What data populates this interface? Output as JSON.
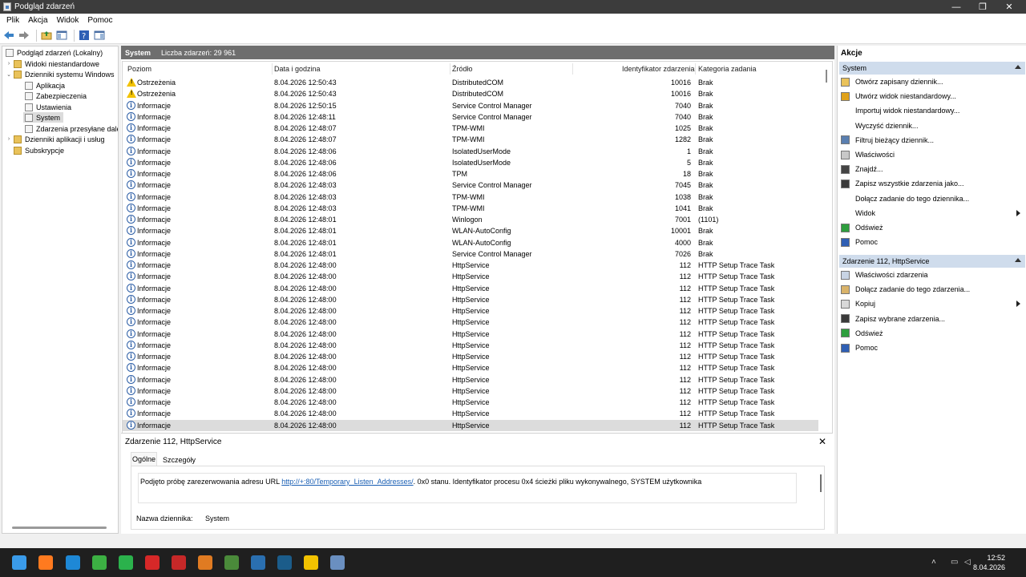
{
  "window": {
    "title": "Podgląd zdarzeń",
    "controls": [
      "—",
      "❐",
      "✕"
    ]
  },
  "menu": [
    "Plik",
    "Akcja",
    "Widok",
    "Pomoc"
  ],
  "toolbar": {
    "icons": [
      "back-arrow-icon",
      "forward-arrow-icon",
      "folder-up-icon",
      "show-hide-tree-icon",
      "help-icon",
      "show-hide-actions-icon"
    ]
  },
  "tree": {
    "items": [
      {
        "label": "Podgląd zdarzeń (Lokalny)",
        "level": 0,
        "arrow": "",
        "icon": "eventviewer-icon"
      },
      {
        "label": "Widoki niestandardowe",
        "level": 1,
        "arrow": "›",
        "icon": "folder-icon"
      },
      {
        "label": "Dzienniki systemu Windows",
        "level": 1,
        "arrow": "⌄",
        "icon": "folder-icon"
      },
      {
        "label": "Aplikacja",
        "level": 2,
        "arrow": "",
        "icon": "log-icon"
      },
      {
        "label": "Zabezpieczenia",
        "level": 2,
        "arrow": "",
        "icon": "log-icon"
      },
      {
        "label": "Ustawienia",
        "level": 2,
        "arrow": "",
        "icon": "log-icon"
      },
      {
        "label": "System",
        "level": 2,
        "arrow": "",
        "icon": "log-icon",
        "selected": true
      },
      {
        "label": "Zdarzenia przesyłane dale",
        "level": 2,
        "arrow": "",
        "icon": "log-icon"
      },
      {
        "label": "Dzienniki aplikacji i usług",
        "level": 1,
        "arrow": "›",
        "icon": "folder-icon"
      },
      {
        "label": "Subskrypcje",
        "level": 1,
        "arrow": "",
        "icon": "folder-icon"
      }
    ]
  },
  "center": {
    "log_name": "System",
    "count_label": "Liczba zdarzeń: 29 961",
    "columns": [
      "Poziom",
      "Data i godzina",
      "Źródło",
      "Identyfikator zdarzenia",
      "Kategoria zadania"
    ],
    "rows": [
      {
        "level": "Ostrzeżenia",
        "type": "warning",
        "date": "8.04.2026 12:50:43",
        "source": "DistributedCOM",
        "id": "10016",
        "category": "Brak"
      },
      {
        "level": "Ostrzeżenia",
        "type": "warning",
        "date": "8.04.2026 12:50:43",
        "source": "DistributedCOM",
        "id": "10016",
        "category": "Brak"
      },
      {
        "level": "Informacje",
        "type": "info",
        "date": "8.04.2026 12:50:15",
        "source": "Service Control Manager",
        "id": "7040",
        "category": "Brak"
      },
      {
        "level": "Informacje",
        "type": "info",
        "date": "8.04.2026 12:48:11",
        "source": "Service Control Manager",
        "id": "7040",
        "category": "Brak"
      },
      {
        "level": "Informacje",
        "type": "info",
        "date": "8.04.2026 12:48:07",
        "source": "TPM-WMI",
        "id": "1025",
        "category": "Brak"
      },
      {
        "level": "Informacje",
        "type": "info",
        "date": "8.04.2026 12:48:07",
        "source": "TPM-WMI",
        "id": "1282",
        "category": "Brak"
      },
      {
        "level": "Informacje",
        "type": "info",
        "date": "8.04.2026 12:48:06",
        "source": "IsolatedUserMode",
        "id": "1",
        "category": "Brak"
      },
      {
        "level": "Informacje",
        "type": "info",
        "date": "8.04.2026 12:48:06",
        "source": "IsolatedUserMode",
        "id": "5",
        "category": "Brak"
      },
      {
        "level": "Informacje",
        "type": "info",
        "date": "8.04.2026 12:48:06",
        "source": "TPM",
        "id": "18",
        "category": "Brak"
      },
      {
        "level": "Informacje",
        "type": "info",
        "date": "8.04.2026 12:48:03",
        "source": "Service Control Manager",
        "id": "7045",
        "category": "Brak"
      },
      {
        "level": "Informacje",
        "type": "info",
        "date": "8.04.2026 12:48:03",
        "source": "TPM-WMI",
        "id": "1038",
        "category": "Brak"
      },
      {
        "level": "Informacje",
        "type": "info",
        "date": "8.04.2026 12:48:03",
        "source": "TPM-WMI",
        "id": "1041",
        "category": "Brak"
      },
      {
        "level": "Informacje",
        "type": "info",
        "date": "8.04.2026 12:48:01",
        "source": "Winlogon",
        "id": "7001",
        "category": "(1101)"
      },
      {
        "level": "Informacje",
        "type": "info",
        "date": "8.04.2026 12:48:01",
        "source": "WLAN-AutoConfig",
        "id": "10001",
        "category": "Brak"
      },
      {
        "level": "Informacje",
        "type": "info",
        "date": "8.04.2026 12:48:01",
        "source": "WLAN-AutoConfig",
        "id": "4000",
        "category": "Brak"
      },
      {
        "level": "Informacje",
        "type": "info",
        "date": "8.04.2026 12:48:01",
        "source": "Service Control Manager",
        "id": "7026",
        "category": "Brak"
      },
      {
        "level": "Informacje",
        "type": "info",
        "date": "8.04.2026 12:48:00",
        "source": "HttpService",
        "id": "112",
        "category": "HTTP Setup Trace Task"
      },
      {
        "level": "Informacje",
        "type": "info",
        "date": "8.04.2026 12:48:00",
        "source": "HttpService",
        "id": "112",
        "category": "HTTP Setup Trace Task"
      },
      {
        "level": "Informacje",
        "type": "info",
        "date": "8.04.2026 12:48:00",
        "source": "HttpService",
        "id": "112",
        "category": "HTTP Setup Trace Task"
      },
      {
        "level": "Informacje",
        "type": "info",
        "date": "8.04.2026 12:48:00",
        "source": "HttpService",
        "id": "112",
        "category": "HTTP Setup Trace Task"
      },
      {
        "level": "Informacje",
        "type": "info",
        "date": "8.04.2026 12:48:00",
        "source": "HttpService",
        "id": "112",
        "category": "HTTP Setup Trace Task"
      },
      {
        "level": "Informacje",
        "type": "info",
        "date": "8.04.2026 12:48:00",
        "source": "HttpService",
        "id": "112",
        "category": "HTTP Setup Trace Task"
      },
      {
        "level": "Informacje",
        "type": "info",
        "date": "8.04.2026 12:48:00",
        "source": "HttpService",
        "id": "112",
        "category": "HTTP Setup Trace Task"
      },
      {
        "level": "Informacje",
        "type": "info",
        "date": "8.04.2026 12:48:00",
        "source": "HttpService",
        "id": "112",
        "category": "HTTP Setup Trace Task"
      },
      {
        "level": "Informacje",
        "type": "info",
        "date": "8.04.2026 12:48:00",
        "source": "HttpService",
        "id": "112",
        "category": "HTTP Setup Trace Task"
      },
      {
        "level": "Informacje",
        "type": "info",
        "date": "8.04.2026 12:48:00",
        "source": "HttpService",
        "id": "112",
        "category": "HTTP Setup Trace Task"
      },
      {
        "level": "Informacje",
        "type": "info",
        "date": "8.04.2026 12:48:00",
        "source": "HttpService",
        "id": "112",
        "category": "HTTP Setup Trace Task"
      },
      {
        "level": "Informacje",
        "type": "info",
        "date": "8.04.2026 12:48:00",
        "source": "HttpService",
        "id": "112",
        "category": "HTTP Setup Trace Task"
      },
      {
        "level": "Informacje",
        "type": "info",
        "date": "8.04.2026 12:48:00",
        "source": "HttpService",
        "id": "112",
        "category": "HTTP Setup Trace Task"
      },
      {
        "level": "Informacje",
        "type": "info",
        "date": "8.04.2026 12:48:00",
        "source": "HttpService",
        "id": "112",
        "category": "HTTP Setup Trace Task"
      },
      {
        "level": "Informacje",
        "type": "info",
        "date": "8.04.2026 12:48:00",
        "source": "HttpService",
        "id": "112",
        "category": "HTTP Setup Trace Task",
        "selected": true
      }
    ]
  },
  "detail": {
    "title": "Zdarzenie 112, HttpService",
    "close": "✕",
    "tabs": [
      "Ogólne",
      "Szczegóły"
    ],
    "message_prefix": "Podjęto próbę zarezerwowania adresu URL ",
    "message_link": "http://+:80/Temporary_Listen_Addresses/",
    "message_suffix": ". 0x0 stanu. Identyfikator procesu 0x4  ścieżki pliku wykonywalnego, SYSTEM  użytkownika",
    "log_name_label": "Nazwa dziennika:",
    "log_name_value": "System"
  },
  "actions": {
    "header": "Akcje",
    "section1": {
      "title": "System",
      "items": [
        {
          "label": "Otwórz zapisany dziennik...",
          "icon": "open-folder-icon",
          "submenu": false
        },
        {
          "label": "Utwórz widok niestandardowy...",
          "icon": "filter-create-icon",
          "submenu": false
        },
        {
          "label": "Importuj widok niestandardowy...",
          "icon": "",
          "submenu": false
        },
        {
          "label": "Wyczyść dziennik...",
          "icon": "",
          "submenu": false
        },
        {
          "label": "Filtruj bieżący dziennik...",
          "icon": "filter-icon",
          "submenu": false
        },
        {
          "label": "Właściwości",
          "icon": "properties-icon",
          "submenu": false
        },
        {
          "label": "Znajdź...",
          "icon": "binoculars-icon",
          "submenu": false
        },
        {
          "label": "Zapisz wszystkie zdarzenia jako...",
          "icon": "save-icon",
          "submenu": false
        },
        {
          "label": "Dołącz zadanie do tego dziennika...",
          "icon": "",
          "submenu": false
        },
        {
          "label": "Widok",
          "icon": "",
          "submenu": true
        },
        {
          "label": "Odśwież",
          "icon": "refresh-icon",
          "submenu": false
        },
        {
          "label": "Pomoc",
          "icon": "help-icon",
          "submenu": false
        }
      ]
    },
    "section2": {
      "title": "Zdarzenie 112, HttpService",
      "items": [
        {
          "label": "Właściwości zdarzenia",
          "icon": "event-properties-icon",
          "submenu": false
        },
        {
          "label": "Dołącz zadanie do tego zdarzenia...",
          "icon": "task-icon",
          "submenu": false
        },
        {
          "label": "Kopiuj",
          "icon": "copy-icon",
          "submenu": true
        },
        {
          "label": "Zapisz wybrane zdarzenia...",
          "icon": "save-icon",
          "submenu": false
        },
        {
          "label": "Odśwież",
          "icon": "refresh-icon",
          "submenu": false
        },
        {
          "label": "Pomoc",
          "icon": "help-icon",
          "submenu": false
        }
      ]
    }
  },
  "taskbar": {
    "apps": [
      {
        "name": "start-icon",
        "color": "#3a9bea"
      },
      {
        "name": "firefox-icon",
        "color": "#ff7a1f"
      },
      {
        "name": "edge-icon",
        "color": "#1e88d6"
      },
      {
        "name": "app-green-icon",
        "color": "#3cb043"
      },
      {
        "name": "app-grid-icon",
        "color": "#2bb24c"
      },
      {
        "name": "app-64-icon",
        "color": "#d62828"
      },
      {
        "name": "app-bolt-icon",
        "color": "#c62828"
      },
      {
        "name": "cpu-z-icon",
        "color": "#e07b22"
      },
      {
        "name": "app-chip-icon",
        "color": "#4a8a3a"
      },
      {
        "name": "settings-gear-icon",
        "color": "#2a6fb0"
      },
      {
        "name": "steam-icon",
        "color": "#1b5c8a"
      },
      {
        "name": "app-3-icon",
        "color": "#f2c200"
      },
      {
        "name": "eventviewer-taskbar-icon",
        "color": "#6a8fc0"
      }
    ],
    "time": "12:52",
    "date": "8.04.2026"
  }
}
